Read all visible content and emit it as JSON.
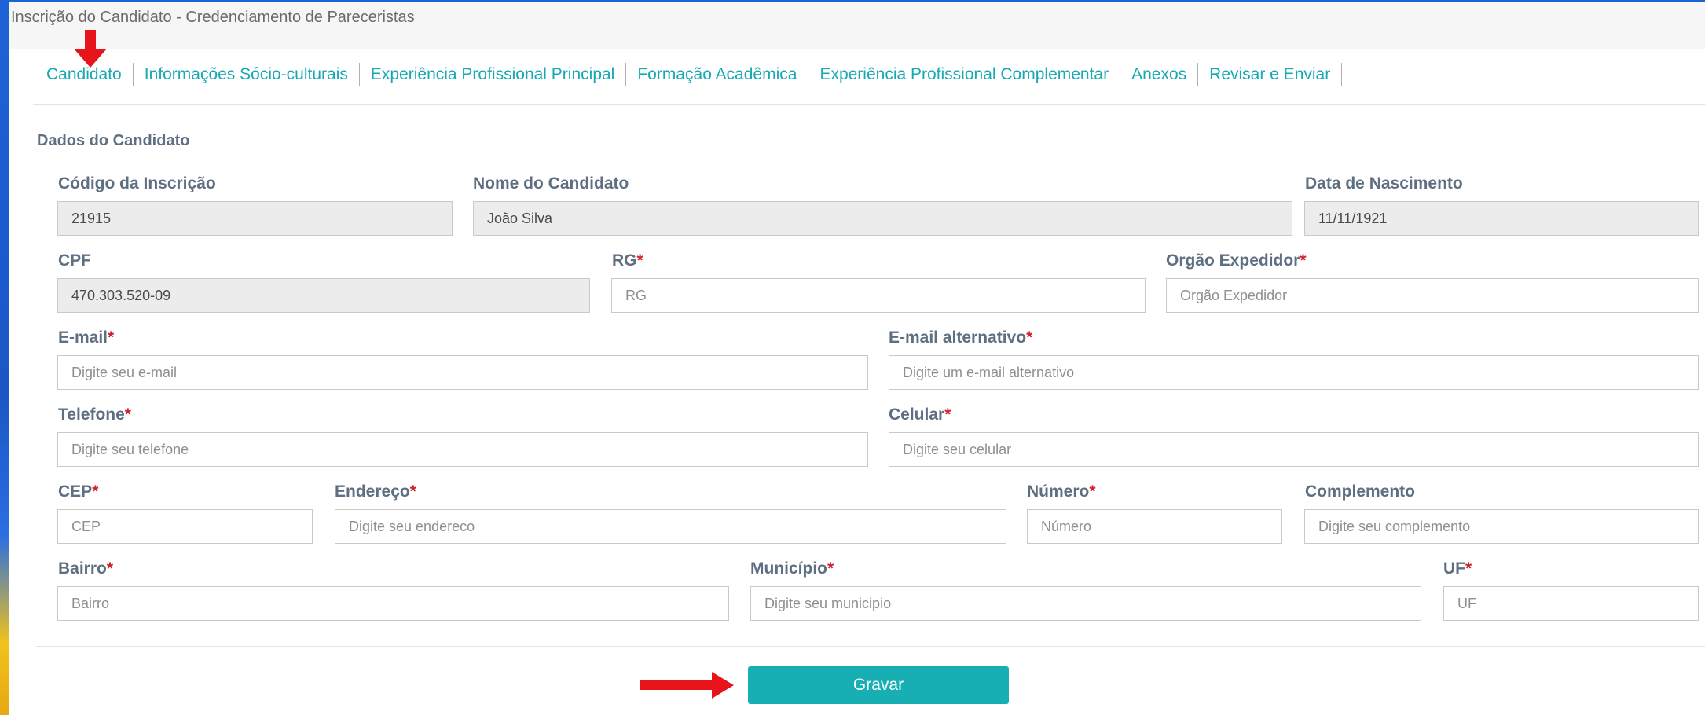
{
  "window": {
    "title": "Inscrição do Candidato - Credenciamento de Pareceristas"
  },
  "tabs": [
    {
      "label": "Candidato",
      "active": true
    },
    {
      "label": "Informações Sócio-culturais"
    },
    {
      "label": "Experiência Profissional Principal"
    },
    {
      "label": "Formação Acadêmica"
    },
    {
      "label": "Experiência Profissional Complementar"
    },
    {
      "label": "Anexos"
    },
    {
      "label": "Revisar e Enviar"
    }
  ],
  "section": {
    "title": "Dados do Candidato"
  },
  "required_mark": "*",
  "fields": {
    "codigo": {
      "label": "Código da Inscrição",
      "value": "21915"
    },
    "nome": {
      "label": "Nome do Candidato",
      "value": "João Silva"
    },
    "nascimento": {
      "label": "Data de Nascimento",
      "value": "11/11/1921"
    },
    "cpf": {
      "label": "CPF",
      "value": "470.303.520-09"
    },
    "rg": {
      "label": "RG",
      "placeholder": "RG"
    },
    "orgao": {
      "label": "Orgão Expedidor",
      "placeholder": "Orgão Expedidor"
    },
    "email": {
      "label": "E-mail",
      "placeholder": "Digite seu e-mail"
    },
    "email_alt": {
      "label": "E-mail alternativo",
      "placeholder": "Digite um e-mail alternativo"
    },
    "telefone": {
      "label": "Telefone",
      "placeholder": "Digite seu telefone"
    },
    "celular": {
      "label": "Celular",
      "placeholder": "Digite seu celular"
    },
    "cep": {
      "label": "CEP",
      "placeholder": "CEP"
    },
    "endereco": {
      "label": "Endereço",
      "placeholder": "Digite seu endereco"
    },
    "numero": {
      "label": "Número",
      "placeholder": "Número"
    },
    "complemento": {
      "label": "Complemento",
      "placeholder": "Digite seu complemento"
    },
    "bairro": {
      "label": "Bairro",
      "placeholder": "Bairro"
    },
    "municipio": {
      "label": "Município",
      "placeholder": "Digite seu municipio"
    },
    "uf": {
      "label": "UF",
      "placeholder": "UF"
    }
  },
  "actions": {
    "save_label": "Gravar"
  },
  "colors": {
    "accent": "#17a8b4",
    "button": "#17aeb4",
    "required": "#d11f2a",
    "annotation_arrow": "#e8141b",
    "label": "#5e6f82"
  }
}
